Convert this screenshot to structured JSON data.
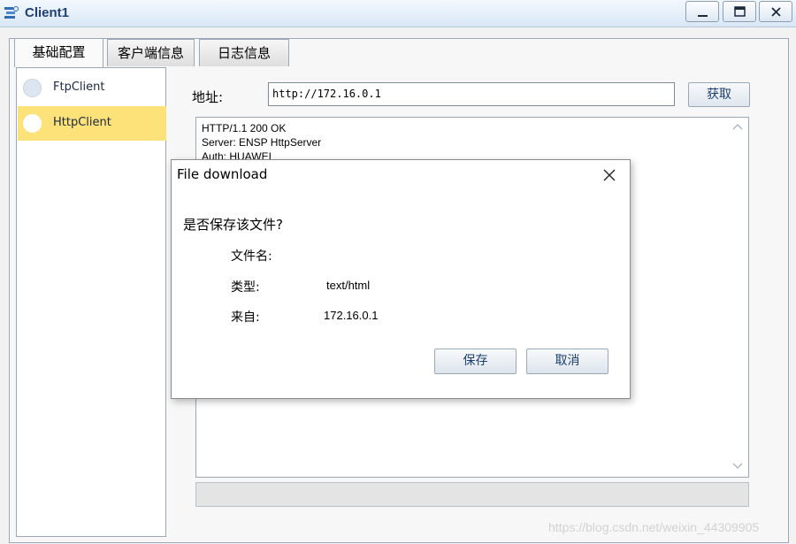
{
  "window": {
    "title": "Client1"
  },
  "tabs": [
    {
      "label": "基础配置"
    },
    {
      "label": "客户端信息"
    },
    {
      "label": "日志信息"
    }
  ],
  "client_list": [
    {
      "label": "FtpClient",
      "selected": false
    },
    {
      "label": "HttpClient",
      "selected": true
    }
  ],
  "address": {
    "label": "地址:",
    "value": "http://172.16.0.1",
    "fetch_label": "获取"
  },
  "response": {
    "lines": [
      "HTTP/1.1 200 OK",
      "Server: ENSP HttpServer",
      "Auth: HUAWEI"
    ]
  },
  "dialog": {
    "title": "File download",
    "question": "是否保存该文件?",
    "filename_label": "文件名:",
    "filename_value": "",
    "type_label": "类型:",
    "type_value": "text/html",
    "from_label": "来自:",
    "from_value": "172.16.0.1",
    "save_label": "保存",
    "cancel_label": "取消"
  },
  "watermark": "https://blog.csdn.net/weixin_44309905",
  "colors": {
    "selected_item": "#fde27a",
    "title_text": "#1f3f75"
  }
}
